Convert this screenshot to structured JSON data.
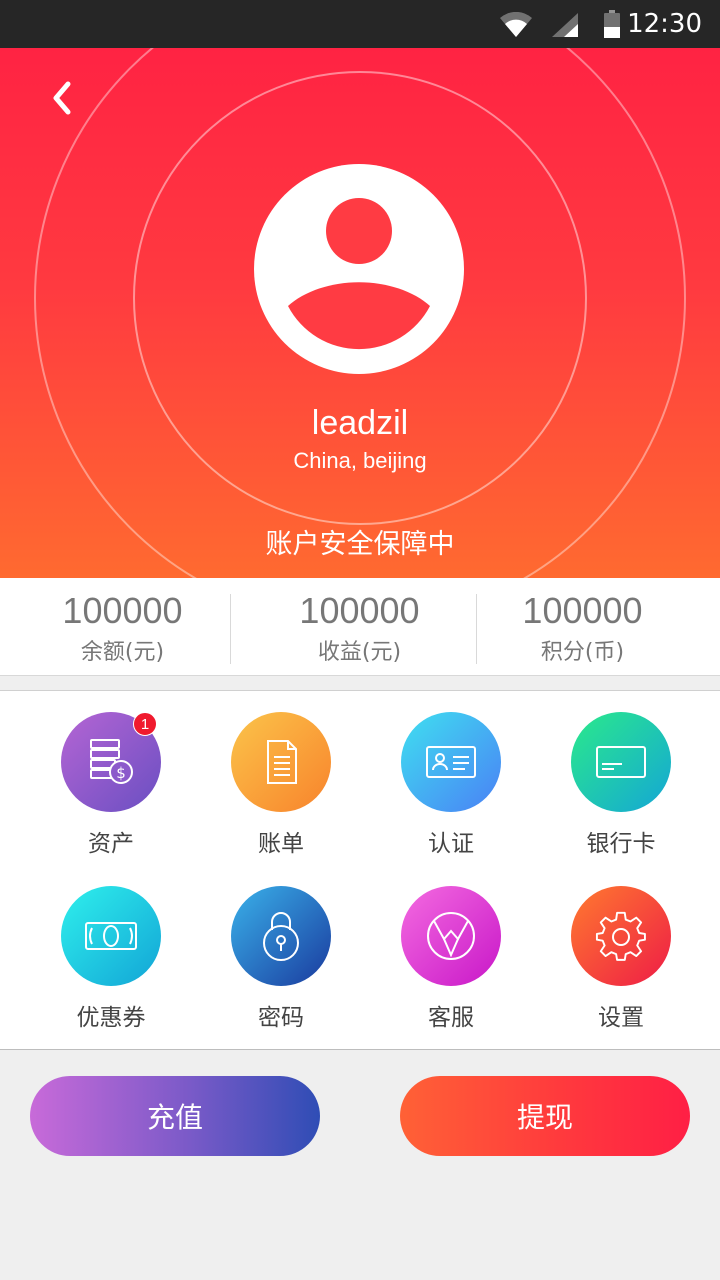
{
  "status_bar": {
    "time": "12:30"
  },
  "profile": {
    "username": "leadzil",
    "location": "China, beijing",
    "security_text": "账户安全保障中"
  },
  "stats": [
    {
      "value": "100000",
      "label": "余额(元)"
    },
    {
      "value": "100000",
      "label": "收益(元)"
    },
    {
      "value": "100000",
      "label": "积分(币)"
    }
  ],
  "menu": [
    {
      "label": "资产",
      "icon": "assets-icon",
      "badge": "1",
      "color_from": "#b565d4",
      "color_to": "#6a4fc2"
    },
    {
      "label": "账单",
      "icon": "bill-icon",
      "color_from": "#fbc44a",
      "color_to": "#f8832c"
    },
    {
      "label": "认证",
      "icon": "id-card-icon",
      "color_from": "#3fe0f0",
      "color_to": "#4a80f5"
    },
    {
      "label": "银行卡",
      "icon": "bank-card-icon",
      "color_from": "#2bea8a",
      "color_to": "#14a6d6"
    },
    {
      "label": "优惠券",
      "icon": "coupon-icon",
      "color_from": "#2ff0ec",
      "color_to": "#12a4d6"
    },
    {
      "label": "密码",
      "icon": "lock-icon",
      "color_from": "#3ab2ea",
      "color_to": "#1a3a9e"
    },
    {
      "label": "客服",
      "icon": "customer-service-icon",
      "color_from": "#f46be0",
      "color_to": "#c817c8"
    },
    {
      "label": "设置",
      "icon": "gear-icon",
      "color_from": "#ff7a2f",
      "color_to": "#ee1c46"
    }
  ],
  "actions": {
    "recharge": "充值",
    "withdraw": "提现"
  }
}
